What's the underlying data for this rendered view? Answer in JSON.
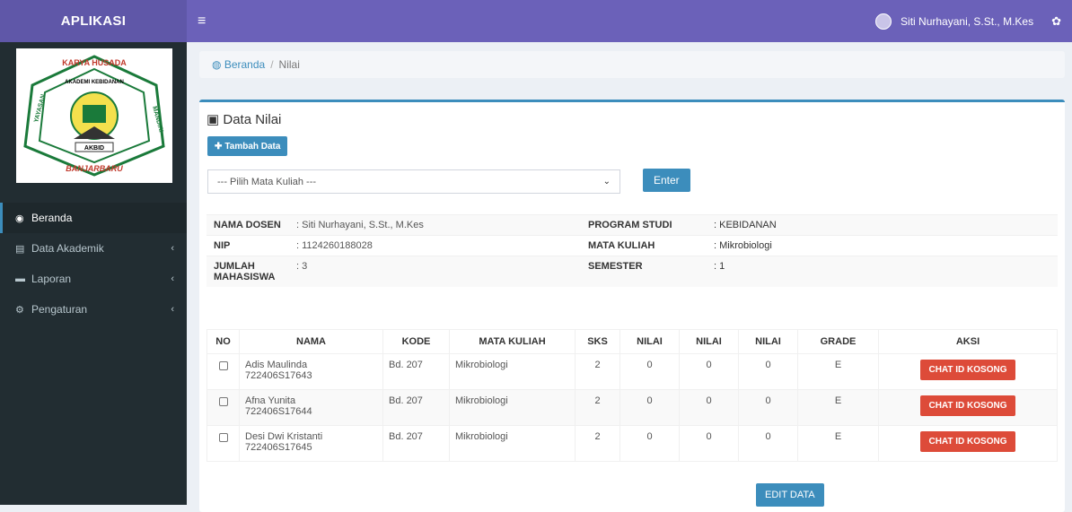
{
  "header": {
    "brand": "APLIKASI",
    "user_name": "Siti Nurhayani, S.St., M.Kes"
  },
  "logo": {
    "top_text": "KARYA HUSADA",
    "middle_text": "AKBID",
    "bottom_text": "BANJARBARU",
    "ring_left": "YAYASAN",
    "ring_right": "MANDIRI",
    "inner_text": "AKADEMI KEBIDANAN"
  },
  "sidebar": {
    "items": [
      {
        "label": "Beranda"
      },
      {
        "label": "Data Akademik"
      },
      {
        "label": "Laporan"
      },
      {
        "label": "Pengaturan"
      }
    ]
  },
  "breadcrumb": {
    "home": "Beranda",
    "sep": "/",
    "current": "Nilai"
  },
  "box": {
    "title": "Data Nilai",
    "add_button": "Tambah Data",
    "select_value": "--- Pilih Mata Kuliah ---",
    "enter_button": "Enter",
    "edit_button": "EDIT DATA"
  },
  "info": {
    "nama_label": "NAMA DOSEN",
    "nama_value": ": Siti Nurhayani, S.St., M.Kes",
    "prodi_label": "PROGRAM STUDI",
    "prodi_value": ": KEBIDANAN",
    "nip_label": "NIP",
    "nip_value": ": 1124260188028",
    "mk_label": "MATA KULIAH",
    "mk_value": ": Mikrobiologi",
    "jumlah_label": "JUMLAH MAHASISWA",
    "jumlah_value": ": 3",
    "semester_label": "SEMESTER",
    "semester_value": ": 1"
  },
  "table": {
    "headers": [
      "NO",
      "NAMA",
      "KODE",
      "MATA KULIAH",
      "SKS",
      "NILAI",
      "NILAI",
      "NILAI",
      "GRADE",
      "AKSI"
    ],
    "rows": [
      {
        "name": "Adis Maulinda",
        "nim": "722406S17643",
        "kode": "Bd. 207",
        "mk": "Mikrobiologi",
        "sks": "2",
        "n1": "0",
        "n2": "0",
        "n3": "0",
        "grade": "E",
        "action": "CHAT ID KOSONG"
      },
      {
        "name": "Afna Yunita",
        "nim": "722406S17644",
        "kode": "Bd. 207",
        "mk": "Mikrobiologi",
        "sks": "2",
        "n1": "0",
        "n2": "0",
        "n3": "0",
        "grade": "E",
        "action": "CHAT ID KOSONG"
      },
      {
        "name": "Desi Dwi Kristanti",
        "nim": "722406S17645",
        "kode": "Bd. 207",
        "mk": "Mikrobiologi",
        "sks": "2",
        "n1": "0",
        "n2": "0",
        "n3": "0",
        "grade": "E",
        "action": "CHAT ID KOSONG"
      }
    ]
  },
  "colors": {
    "brand": "#5f57a8",
    "navbar": "#6b61b9",
    "sidebar": "#222d32",
    "primary": "#3c8dbc",
    "danger": "#dd4b39"
  }
}
